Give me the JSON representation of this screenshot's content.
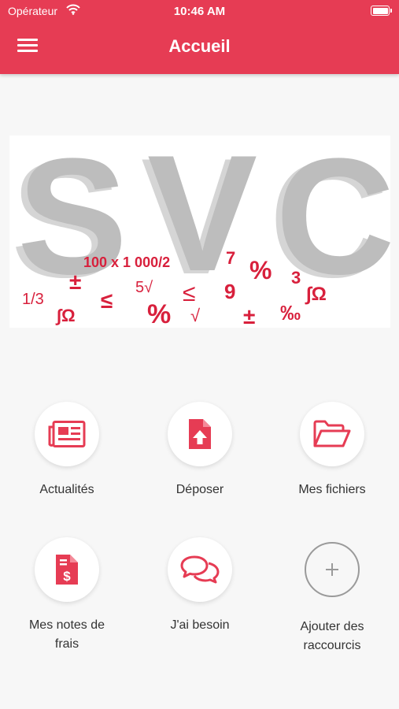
{
  "status_bar": {
    "carrier": "Opérateur",
    "time": "10:46 AM"
  },
  "header": {
    "title": "Accueil"
  },
  "banner": {
    "letters": [
      "S",
      "V",
      "C"
    ],
    "symbols": [
      "100 x 1 000/2",
      "7",
      "%",
      "3",
      "±",
      "5√",
      "9",
      "∫Ω",
      "1/3",
      "≤",
      "≤",
      "∫Ω",
      "%",
      "√",
      "±",
      "‰"
    ]
  },
  "shortcuts": [
    {
      "label": "Actualités",
      "icon": "newspaper-icon"
    },
    {
      "label": "Déposer",
      "icon": "file-upload-icon"
    },
    {
      "label": "Mes fichiers",
      "icon": "folder-open-icon"
    },
    {
      "label": "Mes notes de frais",
      "icon": "invoice-dollar-icon"
    },
    {
      "label": "J'ai besoin",
      "icon": "chat-bubbles-icon"
    },
    {
      "label": "Ajouter des raccourcis",
      "icon": "plus-icon"
    }
  ],
  "colors": {
    "accent": "#e63c54",
    "icon_red": "#e63c54",
    "banner_red": "#d8203c"
  }
}
